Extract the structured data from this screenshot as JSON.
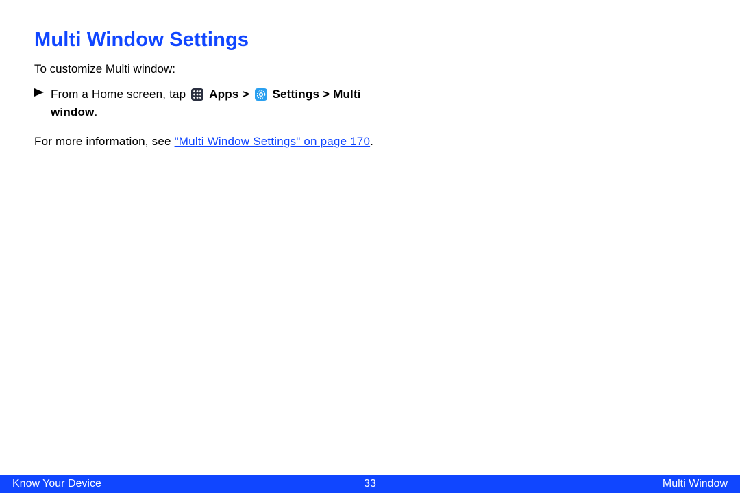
{
  "title": "Multi Window Settings",
  "intro": "To customize Multi window:",
  "step": {
    "prefix": "From a Home screen, tap ",
    "apps_label": "Apps",
    "gt1": " > ",
    "settings_label": "Settings",
    "gt2": " > ",
    "multi_window_label": "Multi window",
    "period": "."
  },
  "more_info": {
    "prefix": "For more information, see ",
    "link_text": "\"Multi Window Settings\" on page 170",
    "period": "."
  },
  "footer": {
    "left": "Know Your Device",
    "center": "33",
    "right": "Multi Window"
  }
}
